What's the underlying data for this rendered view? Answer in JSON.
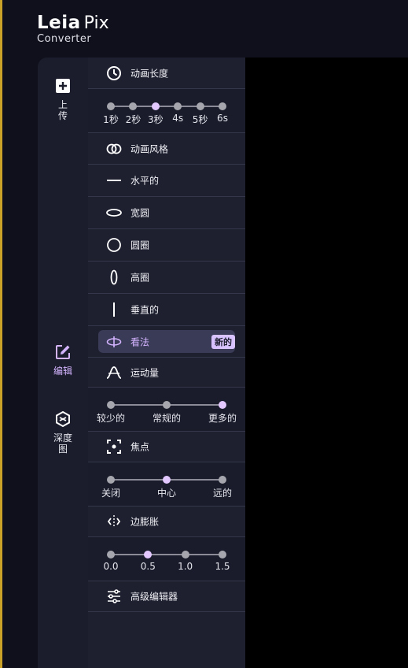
{
  "app": {
    "brand": "Leia",
    "brand2": "Pix",
    "subtitle": "Converter"
  },
  "rail": {
    "upload": "上\n传",
    "edit": "编辑",
    "depth": "深度\n图"
  },
  "duration": {
    "title": "动画长度",
    "ticks": [
      "1秒",
      "2秒",
      "3秒",
      "4s",
      "5秒",
      "6s"
    ],
    "selected_index": 2
  },
  "style": {
    "title": "动画风格",
    "items": [
      {
        "label": "水平的",
        "icon": "horizontal-line-icon"
      },
      {
        "label": "宽圆",
        "icon": "wide-ellipse-icon"
      },
      {
        "label": "圆圈",
        "icon": "circle-icon"
      },
      {
        "label": "高圈",
        "icon": "tall-ellipse-icon"
      },
      {
        "label": "垂直的",
        "icon": "vertical-line-icon"
      },
      {
        "label": "看法",
        "icon": "perspective-icon",
        "badge": "新的",
        "selected": true
      }
    ]
  },
  "motion": {
    "title": "运动量",
    "ticks": [
      "较少的",
      "常规的",
      "更多的"
    ],
    "selected_index": 2
  },
  "focus": {
    "title": "焦点",
    "ticks": [
      "关闭",
      "中心",
      "远的"
    ],
    "selected_index": 1
  },
  "dilation": {
    "title": "边膨胀",
    "ticks": [
      "0.0",
      "0.5",
      "1.0",
      "1.5"
    ],
    "selected_index": 1
  },
  "advanced": {
    "title": "高级编辑器"
  },
  "colors": {
    "accent": "#d8c2ff",
    "panel": "#1e2030",
    "preview": "#000000"
  }
}
